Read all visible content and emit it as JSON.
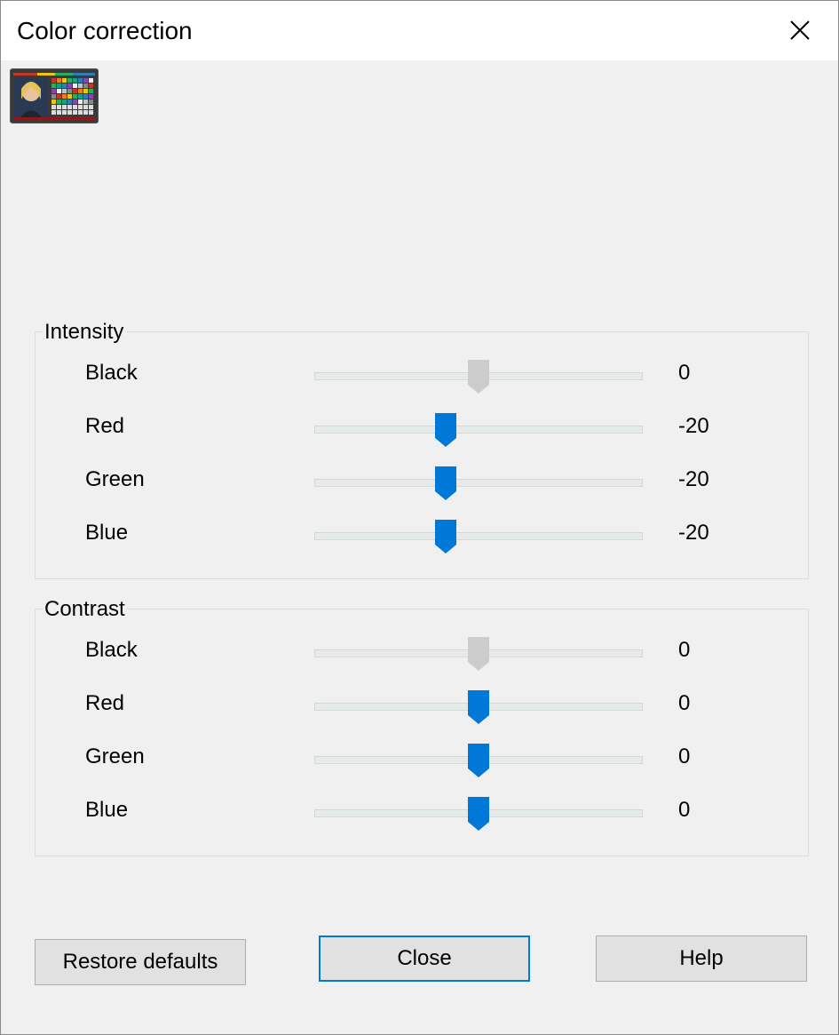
{
  "window": {
    "title": "Color correction",
    "close_icon": "close-icon"
  },
  "preview": {
    "icon": "color-chart-thumbnail-icon"
  },
  "colors": {
    "accent": "#0078d7",
    "disabled_thumb": "#cccccc",
    "background": "#f0f0f0",
    "track": "#e7eaea"
  },
  "slider_range": [
    -100,
    100
  ],
  "intensity": {
    "label": "Intensity",
    "rows": [
      {
        "label": "Black",
        "value": "0",
        "position": 0,
        "enabled": false
      },
      {
        "label": "Red",
        "value": "-20",
        "position": -20,
        "enabled": true
      },
      {
        "label": "Green",
        "value": "-20",
        "position": -20,
        "enabled": true
      },
      {
        "label": "Blue",
        "value": "-20",
        "position": -20,
        "enabled": true
      }
    ]
  },
  "contrast": {
    "label": "Contrast",
    "rows": [
      {
        "label": "Black",
        "value": "0",
        "position": 0,
        "enabled": false
      },
      {
        "label": "Red",
        "value": "0",
        "position": 0,
        "enabled": true
      },
      {
        "label": "Green",
        "value": "0",
        "position": 0,
        "enabled": true
      },
      {
        "label": "Blue",
        "value": "0",
        "position": 0,
        "enabled": true
      }
    ]
  },
  "buttons": {
    "restore": "Restore defaults",
    "close": "Close",
    "help": "Help"
  }
}
